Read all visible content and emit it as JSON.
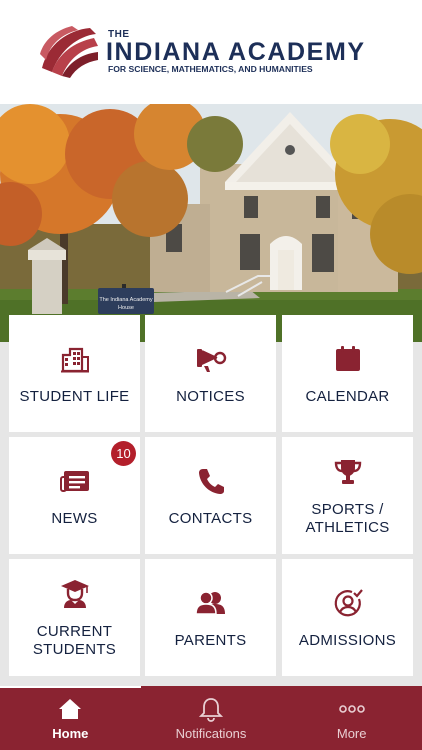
{
  "brand": {
    "the": "THE",
    "name": "INDIANA ACADEMY",
    "subtitle": "FOR SCIENCE, MATHEMATICS, AND HUMANITIES",
    "primary_color": "#8a2331",
    "text_color": "#1d2f58"
  },
  "hero": {
    "sign_text_line1": "The Indiana Academy",
    "sign_text_line2": "House"
  },
  "tiles": [
    {
      "label": "STUDENT LIFE",
      "icon": "building-icon"
    },
    {
      "label": "NOTICES",
      "icon": "megaphone-icon"
    },
    {
      "label": "CALENDAR",
      "icon": "calendar-icon"
    },
    {
      "label": "NEWS",
      "icon": "newspaper-icon",
      "badge": "10"
    },
    {
      "label": "CONTACTS",
      "icon": "phone-icon"
    },
    {
      "label": "SPORTS / ATHLETICS",
      "icon": "trophy-icon"
    },
    {
      "label": "CURRENT STUDENTS",
      "icon": "graduate-icon"
    },
    {
      "label": "PARENTS",
      "icon": "people-icon"
    },
    {
      "label": "ADMISSIONS",
      "icon": "user-check-icon"
    }
  ],
  "tabbar": {
    "items": [
      {
        "label": "Home",
        "icon": "home-icon",
        "active": true
      },
      {
        "label": "Notifications",
        "icon": "bell-icon",
        "active": false
      },
      {
        "label": "More",
        "icon": "more-icon",
        "active": false
      }
    ]
  }
}
